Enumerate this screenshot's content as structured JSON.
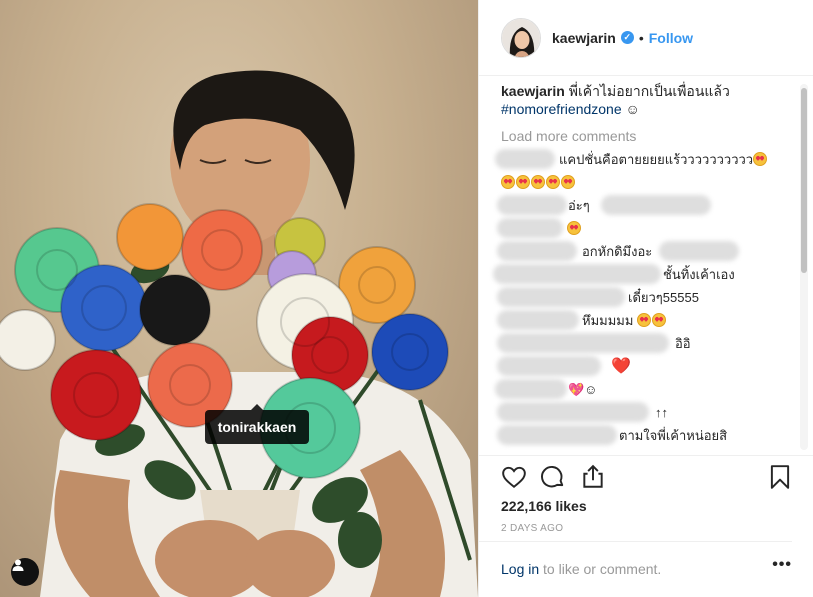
{
  "photo": {
    "tag_label": "tonirakkaen",
    "user_tag_icon": "person-icon"
  },
  "header": {
    "username": "kaewjarin",
    "verified_icon": "verified-badge-icon",
    "separator": "•",
    "follow_label": "Follow"
  },
  "caption": {
    "username": "kaewjarin",
    "text": "พี่เค้าไม่อยากเป็นเพื่อนแล้ว",
    "hashtag": "#nomorefriendzone",
    "emoji": "☺"
  },
  "load_more": "Load more comments",
  "comments": [
    {
      "text": "แคปชั่นคือตายยยยแร้วววววววววว",
      "emoji_count": 1
    },
    {
      "text": "",
      "emoji_count": 5
    },
    {
      "text": "อ่ะๆ",
      "emoji_count": 0
    },
    {
      "text": "",
      "emoji_count": 1
    },
    {
      "text": "อกหักดิมึงอะ",
      "emoji_count": 0
    },
    {
      "text": "ชั้นทิ้งเค้าเอง",
      "emoji_count": 0
    },
    {
      "text": "เดี๋ยวๆ55555",
      "emoji_count": 0
    },
    {
      "text": "หึมมมมม",
      "emoji_count": 2
    },
    {
      "text": "อิอิ",
      "emoji_count": 0
    },
    {
      "text": "❤️",
      "emoji_count": 0
    },
    {
      "text": "💖☺",
      "emoji_count": 0
    },
    {
      "text": "↑↑",
      "emoji_count": 0
    },
    {
      "text": "ตามใจพี่เค้าหน่อยสิ",
      "emoji_count": 0
    }
  ],
  "actions": {
    "like_icon": "heart-icon",
    "comment_icon": "comment-icon",
    "share_icon": "share-icon",
    "save_icon": "bookmark-icon",
    "likes": "222,166 likes",
    "time_ago": "2 DAYS AGO",
    "login_link": "Log in",
    "login_rest": " to like or comment.",
    "more_icon": "more-options-icon",
    "more_label": "•••"
  },
  "colors": {
    "link_blue": "#3897f0",
    "hashtag": "#003569",
    "muted": "#999999",
    "heart_red": "#e0243b"
  }
}
